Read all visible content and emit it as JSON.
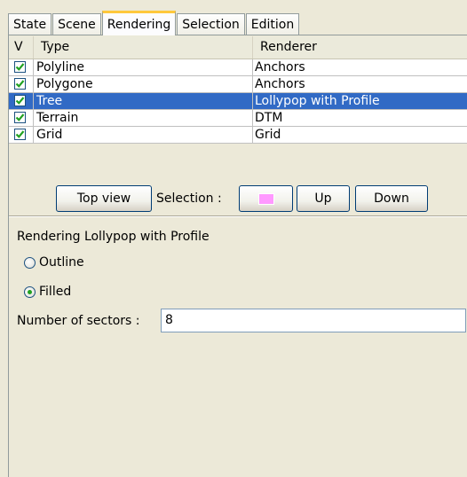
{
  "tabs": [
    "State",
    "Scene",
    "Rendering",
    "Selection",
    "Edition"
  ],
  "table": {
    "columns": {
      "v": "V",
      "type": "Type",
      "renderer": "Renderer"
    },
    "rows": [
      {
        "type": "Polyline",
        "renderer": "Anchors",
        "checked": true
      },
      {
        "type": "Polygone",
        "renderer": "Anchors",
        "checked": true
      },
      {
        "type": "Tree",
        "renderer": "Lollypop with Profile",
        "checked": true,
        "selected": true
      },
      {
        "type": "Terrain",
        "renderer": "DTM",
        "checked": true
      },
      {
        "type": "Grid",
        "renderer": "Grid",
        "checked": true
      }
    ]
  },
  "toolbar": {
    "top_view": "Top view",
    "selection_label": "Selection :",
    "selection_color": "#ff99ff",
    "up": "Up",
    "down": "Down"
  },
  "options": {
    "title": "Rendering Lollypop with Profile",
    "outline": "Outline",
    "filled": "Filled",
    "selected_mode": "Filled",
    "sectors_label": "Number of sectors :",
    "sectors_value": "8"
  },
  "colors": {
    "selection_highlight": "#316ac5",
    "check_mark": "#21a121",
    "active_tab_accent": "#ffc83c"
  }
}
